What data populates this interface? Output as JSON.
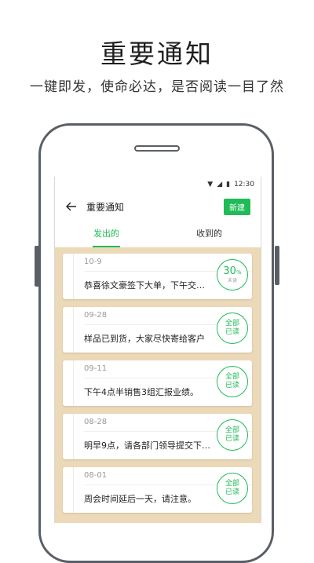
{
  "promo": {
    "title": "重要通知",
    "subtitle": "一键即发，使命必达，是否阅读一目了然"
  },
  "statusbar": {
    "time": "12:30"
  },
  "topbar": {
    "title": "重要通知",
    "new_label": "新建"
  },
  "tabs": [
    {
      "label": "发出的",
      "active": true
    },
    {
      "label": "收到的",
      "active": false
    }
  ],
  "notices": [
    {
      "date": "10-9",
      "text": "恭喜徐文豪签下大单，下午交…",
      "stamp_num": "30",
      "stamp_unit": "%",
      "stamp_small": "未读"
    },
    {
      "date": "09-28",
      "text": "样品已到货，大家尽快寄给客户",
      "stamp_line1": "全部",
      "stamp_line2": "已读"
    },
    {
      "date": "09-11",
      "text": "下午4点半销售3组汇报业绩。",
      "stamp_line1": "全部",
      "stamp_line2": "已读"
    },
    {
      "date": "08-28",
      "text": "明早9点，请各部门领导提交下…",
      "stamp_line1": "全部",
      "stamp_line2": "已读"
    },
    {
      "date": "08-01",
      "text": "周会时间延后一天，请注意。",
      "stamp_line1": "全部",
      "stamp_line2": "已读"
    }
  ],
  "colors": {
    "accent": "#1fbb57",
    "list_bg": "#ecd9b8",
    "frame": "#5a5f66"
  }
}
